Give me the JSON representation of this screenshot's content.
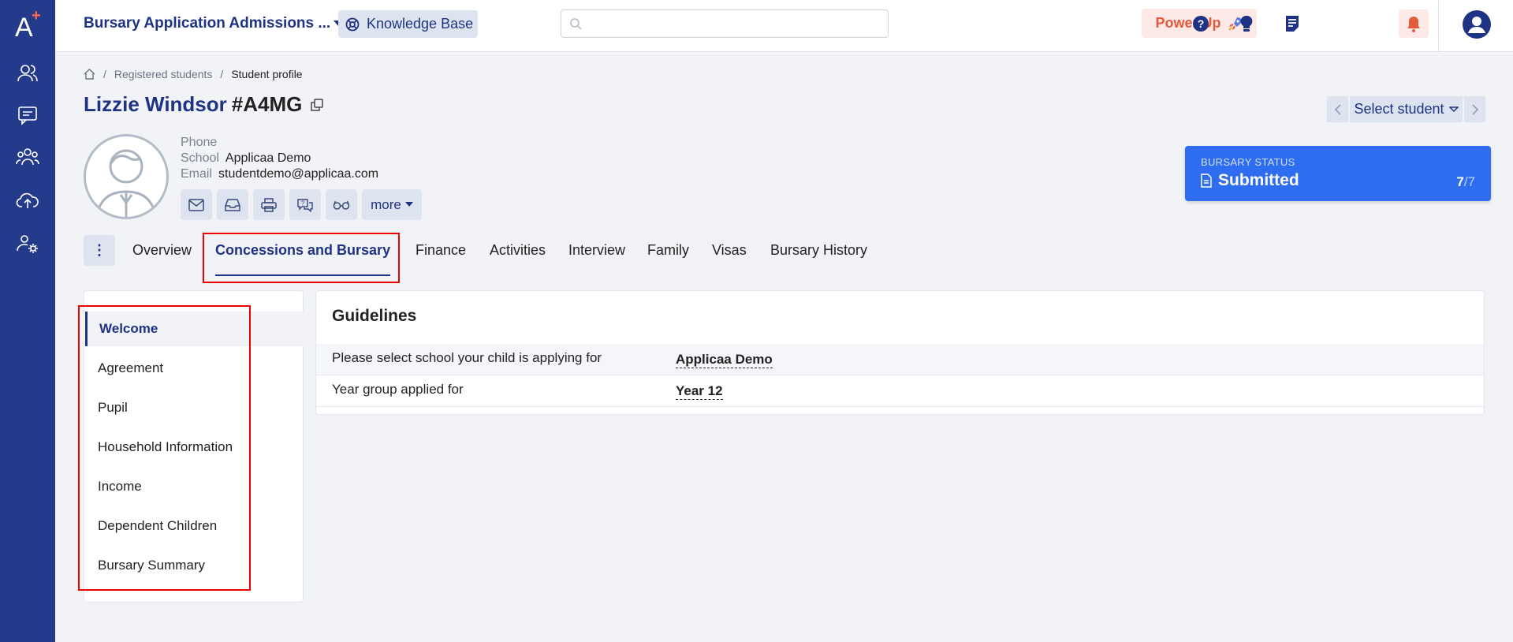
{
  "app": {
    "title": "Bursary Application Admissions ...",
    "knowledge_base": "Knowledge Base",
    "search_placeholder": "",
    "power_up": "Power Up"
  },
  "colors": {
    "sidebar": "#243b8c",
    "brand": "#1f3384",
    "accent_red": "#e45a3c",
    "status_blue": "#2f6df0"
  },
  "sidebar": {
    "items": [
      {
        "icon": "people-icon"
      },
      {
        "icon": "message-icon"
      },
      {
        "icon": "group-icon"
      },
      {
        "icon": "cloud-upload-icon"
      },
      {
        "icon": "users-settings-icon"
      }
    ]
  },
  "topbar_icons": [
    "help-icon",
    "lightbulb-icon",
    "notes-icon",
    "bell-icon",
    "user-avatar-icon"
  ],
  "breadcrumb": {
    "items": [
      "Registered students",
      "Student profile"
    ]
  },
  "student": {
    "name": "Lizzie Windsor",
    "id": "#A4MG",
    "phone_label": "Phone",
    "phone": "",
    "school_label": "School",
    "school": "Applicaa Demo",
    "email_label": "Email",
    "email": "studentdemo@applicaa.com",
    "more_label": "more"
  },
  "pager": {
    "select_label": "Select student"
  },
  "status": {
    "label": "BURSARY STATUS",
    "value": "Submitted",
    "done": "7",
    "total": "/7"
  },
  "tabs": [
    "Overview",
    "Concessions and Bursary",
    "Finance",
    "Activities",
    "Interview",
    "Family",
    "Visas",
    "Bursary History"
  ],
  "active_tab": "Concessions and Bursary",
  "side_menu": [
    "Welcome",
    "Agreement",
    "Pupil",
    "Household Information",
    "Income",
    "Dependent Children",
    "Bursary Summary"
  ],
  "guidelines": {
    "heading": "Guidelines",
    "rows": [
      {
        "question": "Please select school your child is applying for",
        "answer": "Applicaa Demo"
      },
      {
        "question": "Year group applied for",
        "answer": "Year 12"
      }
    ]
  }
}
